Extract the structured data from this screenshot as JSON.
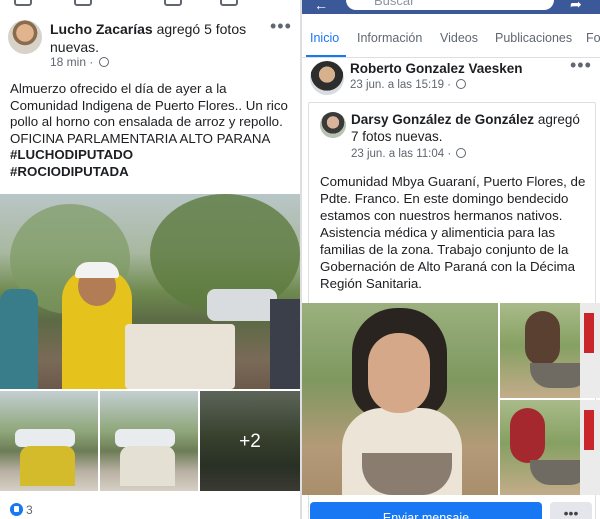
{
  "left_post": {
    "author": "Lucho Zacarías",
    "action": " agregó 5 fotos nuevas.",
    "time": "18 min",
    "text": "Almuerzo ofrecido el día de ayer a la Comunidad Indigena de Puerto Flores.. Un rico pollo al horno con ensalada de arroz y repollo. OFICINA PARLAMENTARIA ALTO PARANA",
    "hashtags": [
      "#LUCHODIPUTADO",
      "#ROCIODIPUTADA"
    ],
    "more_photos": "+2",
    "reactions_count": "3"
  },
  "right_header": {
    "search_placeholder": "Buscar",
    "tabs": [
      "Inicio",
      "Información",
      "Videos",
      "Publicaciones",
      "Fo"
    ]
  },
  "right_post": {
    "author": "Roberto Gonzalez Vaesken",
    "time": "23 jun. a las 15:19 ·",
    "shared": {
      "author": "Darsy González de González",
      "action": " agregó 7 fotos nuevas.",
      "time": "23 jun. a las 11:04 ·",
      "text": "Comunidad Mbya Guaraní, Puerto Flores, de Pdte. Franco. En este domingo bendecido estamos con nuestros hermanos nativos. Asistencia médica y alimenticia para las familias de la zona. Trabajo conjunto de la Gobernación de Alto Paraná con la Décima Región Sanitaria."
    },
    "send_message_label": "Enviar mensaje"
  },
  "colors": {
    "facebook_blue": "#1877f2",
    "header_blue": "#3b5998",
    "secondary_text": "#606770"
  }
}
